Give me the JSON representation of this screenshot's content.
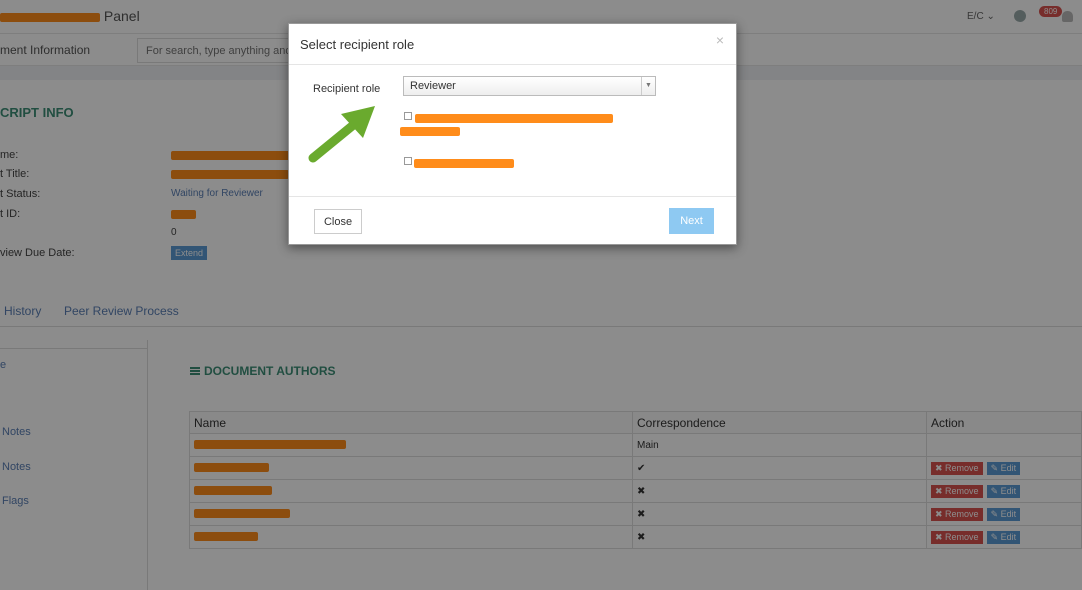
{
  "header": {
    "title_suffix": "Panel",
    "lang": "E/C",
    "notification_count": "809"
  },
  "subbar": {
    "label": "ment Information",
    "search_placeholder": "For search, type anything and"
  },
  "info": {
    "section_title": "CRIPT INFO",
    "labels": [
      "me:",
      "t Title:",
      "t Status:",
      "t ID:",
      "view Due Date:"
    ],
    "status_value": "Waiting for Reviewer",
    "count_value": "0",
    "extend_label": "Extend"
  },
  "tabs": [
    "History",
    "Peer Review Process"
  ],
  "sidebar": {
    "items": [
      "e",
      "Notes",
      "Notes",
      "Flags"
    ]
  },
  "authors": {
    "title": "DOCUMENT AUTHORS",
    "headers": [
      "Name",
      "Correspondence",
      "Action"
    ],
    "rows": [
      {
        "correspondence": "Main",
        "actions": false
      },
      {
        "correspondence": "✔",
        "actions": true
      },
      {
        "correspondence": "✖",
        "actions": true
      },
      {
        "correspondence": "✖",
        "actions": true
      },
      {
        "correspondence": "✖",
        "actions": true
      }
    ],
    "remove_label": "✖ Remove",
    "edit_label": "✎ Edit"
  },
  "modal": {
    "title": "Select recipient role",
    "close_glyph": "×",
    "role_label": "Recipient role",
    "role_value": "Reviewer",
    "close_button": "Close",
    "next_button": "Next"
  },
  "colors": {
    "accent_green": "#3d8f77",
    "link_blue": "#5a7fb5",
    "danger": "#d9534f",
    "arrow_green": "#6aaa2e",
    "redaction": "#ff8c1a"
  }
}
